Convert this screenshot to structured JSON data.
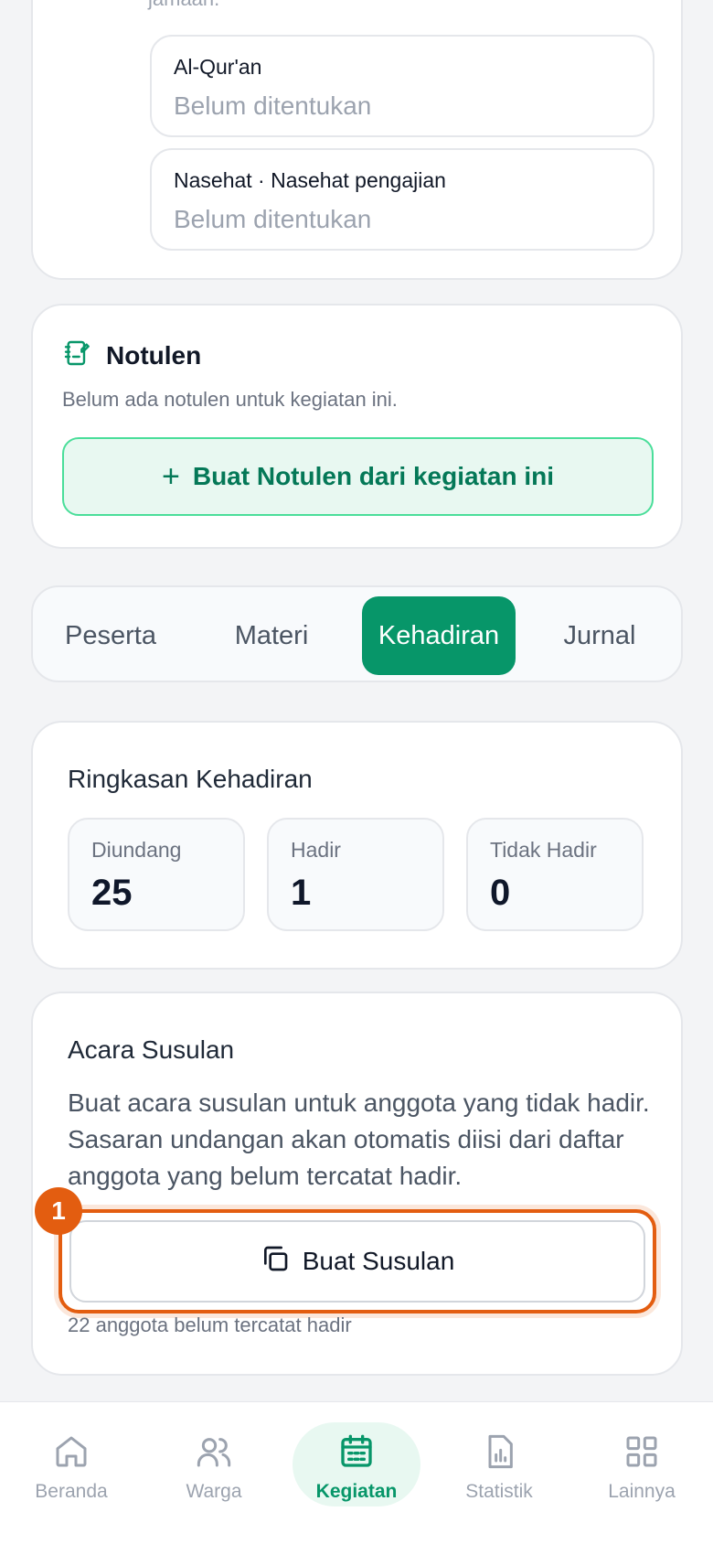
{
  "top_card": {
    "partial_text": "jamaah.",
    "items": [
      {
        "title": "Al-Qur'an",
        "value": "Belum ditentukan"
      },
      {
        "title": "Nasehat · Nasehat pengajian",
        "value": "Belum ditentukan"
      }
    ]
  },
  "notulen": {
    "title": "Notulen",
    "description": "Belum ada notulen untuk kegiatan ini.",
    "button_label": "Buat Notulen dari kegiatan ini",
    "button_icon": "+"
  },
  "tabs": {
    "items": [
      "Peserta",
      "Materi",
      "Kehadiran",
      "Jurnal"
    ],
    "active": "Kehadiran"
  },
  "ringkasan": {
    "title": "Ringkasan Kehadiran",
    "stats": [
      {
        "label": "Diundang",
        "value": "25"
      },
      {
        "label": "Hadir",
        "value": "1"
      },
      {
        "label": "Tidak Hadir",
        "value": "0"
      }
    ]
  },
  "susulan": {
    "title": "Acara Susulan",
    "description": "Buat acara susulan untuk anggota yang tidak hadir. Sasaran undangan akan otomatis diisi dari daftar anggota yang belum tercatat hadir.",
    "button_label": "Buat Susulan",
    "marker": "1",
    "note": "22 anggota belum tercatat hadir"
  },
  "bottom_nav": {
    "items": [
      {
        "label": "Beranda",
        "icon": "home-icon"
      },
      {
        "label": "Warga",
        "icon": "users-icon"
      },
      {
        "label": "Kegiatan",
        "icon": "calendar-icon"
      },
      {
        "label": "Statistik",
        "icon": "chart-icon"
      },
      {
        "label": "Lainnya",
        "icon": "grid-icon"
      }
    ],
    "active": "Kegiatan"
  },
  "colors": {
    "primary": "#079669",
    "highlight": "#e35d10",
    "background": "#f3f4f6"
  }
}
